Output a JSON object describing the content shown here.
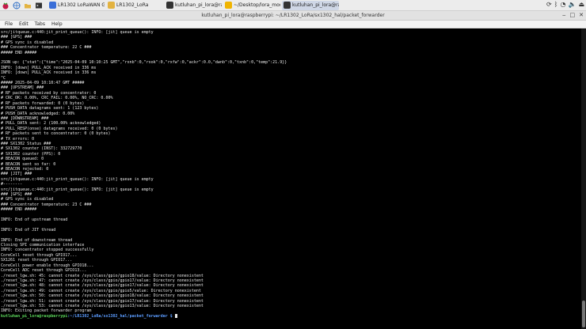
{
  "taskbar": {
    "tasks": [
      {
        "label": "LR1302 LoRaWAN G...",
        "icon": "chromium-icon",
        "color": "#3b6fd8"
      },
      {
        "label": "LR1302_LoRa",
        "icon": "folder-icon",
        "color": "#e3b341"
      },
      {
        "label": "kutluhan_pi_lora@ra...",
        "icon": "terminal-icon",
        "color": "#333333"
      },
      {
        "label": "~/Desktop/lora_mod...",
        "icon": "editor-icon",
        "color": "#f0b400"
      },
      {
        "label": "kutluhan_pi_lora@ra...",
        "icon": "terminal-icon",
        "color": "#333333"
      }
    ]
  },
  "window": {
    "title": "kutluhan_pi_lora@raspberrypi: ~/LR1302_LoRa/sx1302_hal/packet_forwarder"
  },
  "menu": [
    "File",
    "Edit",
    "Tabs",
    "Help"
  ],
  "prompt": {
    "user": "kutluhan_pi_lora@raspberrypi",
    "path": ":~/LR1302_LoRa/sx1302_hal/packet_forwarder $"
  },
  "terminal_lines": [
    "src/jitqueue.c:440:jit_print_queue(): INFO: [jit] queue is empty",
    "### [GPS] ###",
    "# GPS sync is disabled",
    "### Concentrator temperature: 22 C ###",
    "##### END #####",
    "",
    "JSON up: {\"stat\":{\"time\":\"2025-04-09 10:10:25 GMT\",\"rxnb\":0,\"rxok\":0,\"rxfw\":0,\"ackr\":0.0,\"dwnb\":0,\"txnb\":0,\"temp\":21.9}}",
    "INFO: [down] PULL_ACK received in 336 ms",
    "INFO: [down] PULL_ACK received in 336 ms",
    "^C",
    "##### 2025-04-09 10:10:47 GMT #####",
    "### [UPSTREAM] ###",
    "# RF packets received by concentrator: 0",
    "# CRC_OK: 0.00%, CRC_FAIL: 0.00%, NO_CRC: 0.00%",
    "# RF packets forwarded: 0 (0 bytes)",
    "# PUSH_DATA datagrams sent: 1 (123 bytes)",
    "# PUSH_DATA acknowledged: 0.00%",
    "### [DOWNSTREAM] ###",
    "# PULL_DATA sent: 2 (100.00% acknowledged)",
    "# PULL_RESP(onse) datagrams received: 0 (0 bytes)",
    "# RF packets sent to concentrator: 0 (0 bytes)",
    "# TX errors: 0",
    "### SX1302 Status ###",
    "# SX1302 counter (INST): 332729770",
    "# SX1302 counter (PPS): 0",
    "# BEACON queued: 0",
    "# BEACON sent so far: 0",
    "# BEACON rejected: 0",
    "### [JIT] ###",
    "src/jitqueue.c:440:jit_print_queue(): INFO: [jit] queue is empty",
    "#--------",
    "src/jitqueue.c:440:jit_print_queue(): INFO: [jit] queue is empty",
    "### [GPS] ###",
    "# GPS sync is disabled",
    "### Concentrator temperature: 23 C ###",
    "##### END #####",
    "",
    "INFO: End of upstream thread",
    "",
    "INFO: End of JIT thread",
    "",
    "INFO: End of downstream thread",
    "Closing SPI communication interface",
    "INFO: concentrator stopped successfully",
    "CoreCell reset through GPIO17...",
    "SX1261 reset through GPIO17...",
    "CoreCell power enable through GPIO18...",
    "CoreCell ADC reset through GPIO13...",
    "./reset_lgw.sh: 45: cannot create /sys/class/gpio/gpio18/value: Directory nonexistent",
    "./reset_lgw.sh: 47: cannot create /sys/class/gpio/gpio17/value: Directory nonexistent",
    "./reset_lgw.sh: 48: cannot create /sys/class/gpio/gpio17/value: Directory nonexistent",
    "./reset_lgw.sh: 49: cannot create /sys/class/gpio/gpio5/value: Directory nonexistent",
    "./reset_lgw.sh: 50: cannot create /sys/class/gpio/gpio18/value: Directory nonexistent",
    "./reset_lgw.sh: 51: cannot create /sys/class/gpio/gpio17/value: Directory nonexistent",
    "./reset_lgw.sh: 53: cannot create /sys/class/gpio/gpio13/value: Directory nonexistent",
    "INFO: Exiting packet forwarder program"
  ],
  "colors": {
    "prompt_user": "#5bd75b",
    "prompt_path": "#5b9cff",
    "terminal_bg": "#000000",
    "terminal_fg": "#e8e8e8"
  }
}
